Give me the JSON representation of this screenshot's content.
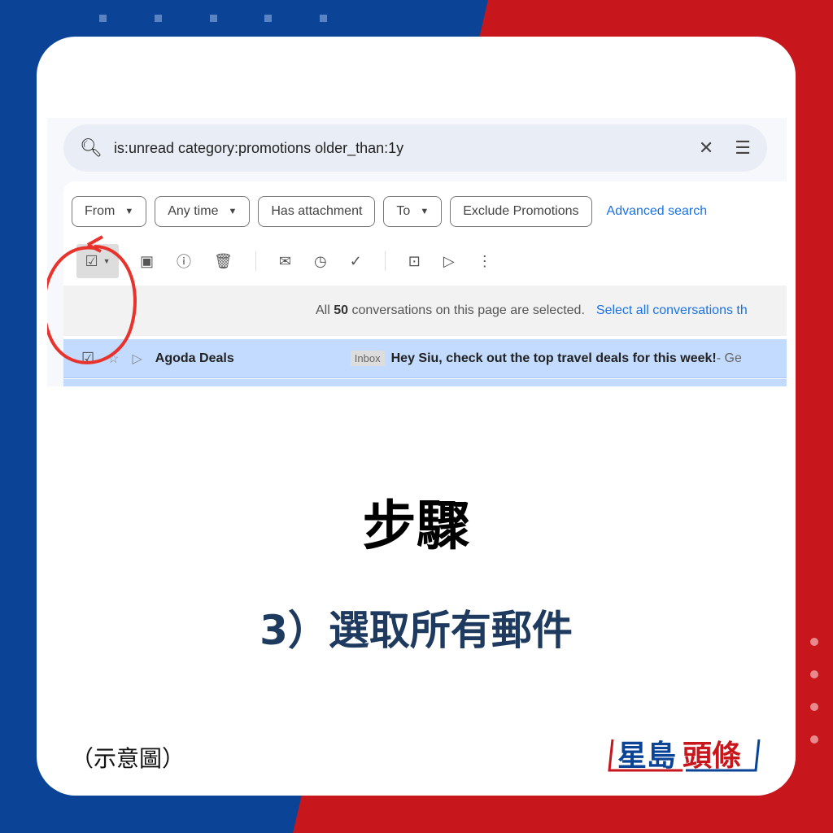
{
  "colors": {
    "blue": "#0b4496",
    "red": "#c8161d",
    "accent": "#1a73e8"
  },
  "search": {
    "query": "is:unread category:promotions older_than:1y",
    "icon": "search-icon",
    "clear_icon": "close-icon",
    "options_icon": "tune-icon"
  },
  "filters": {
    "from": "From",
    "any_time": "Any time",
    "has_attachment": "Has attachment",
    "to": "To",
    "exclude": "Exclude Promotions",
    "advanced": "Advanced search"
  },
  "banner": {
    "prefix": "All",
    "count": "50",
    "suffix": "conversations on this page are selected.",
    "link": "Select all conversations th"
  },
  "email": {
    "sender": "Agoda Deals",
    "label": "Inbox",
    "subject": "Hey Siu, check out the top travel deals for this week!",
    "snippet": " - Ge"
  },
  "title": "步驟",
  "subtitle": "3）選取所有郵件",
  "note": "（示意圖）",
  "logo": "星島頭條"
}
